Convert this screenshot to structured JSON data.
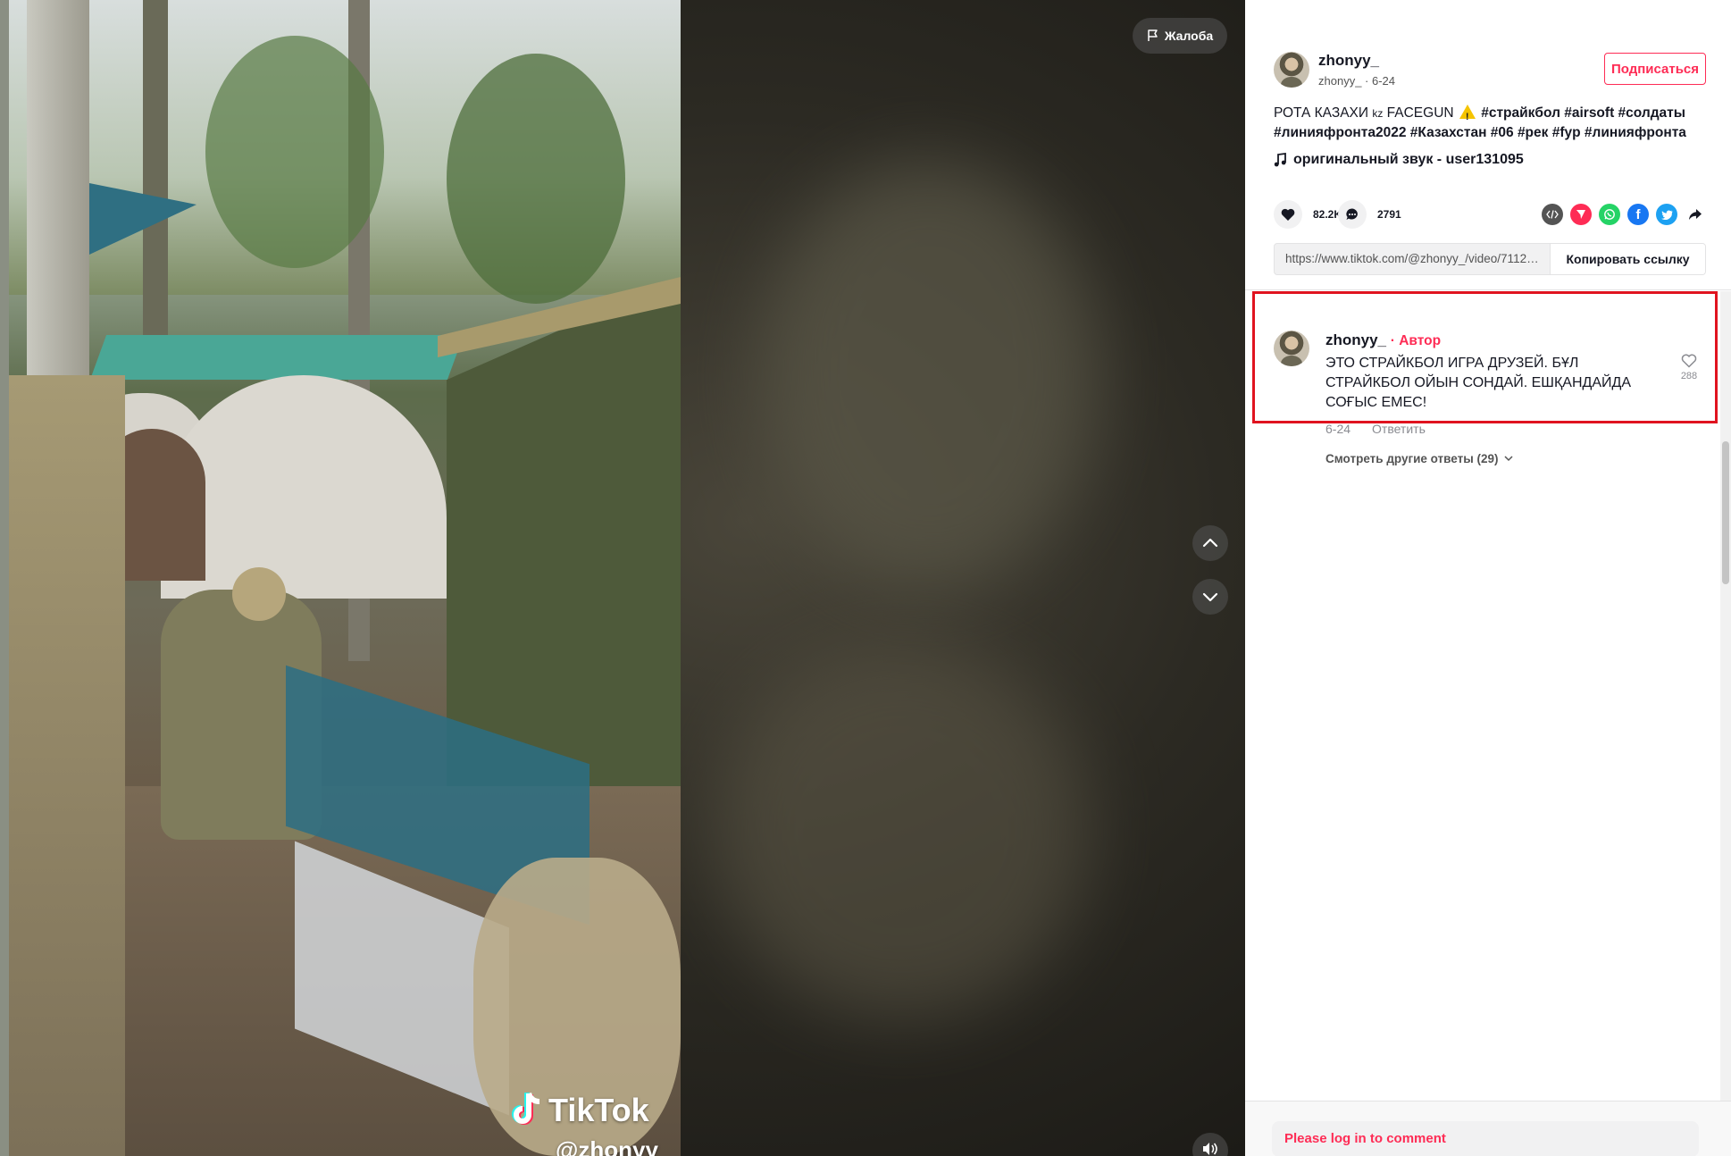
{
  "video": {
    "report_label": "Жалоба",
    "watermark_brand": "TikTok",
    "watermark_user": "@zhonyy_"
  },
  "author": {
    "username": "zhonyy_",
    "nickname": "zhonyy_",
    "date": "6-24",
    "follow_label": "Подписаться"
  },
  "description": {
    "text_prefix": "РОТА КАЗАХИ ",
    "kz": "kz",
    "text_mid": " FACEGUN ",
    "hashtags": [
      "#страйкбол",
      "#airsoft",
      "#солдаты",
      "#линияфронта2022",
      "#Казахстан",
      "#06",
      "#рек",
      "#fyp",
      "#линияфронта"
    ]
  },
  "music": {
    "title": "оригинальный звук - user131095"
  },
  "stats": {
    "likes": "82.2K",
    "comments": "2791"
  },
  "share": {
    "link": "https://www.tiktok.com/@zhonyy_/video/71126...",
    "copy_label": "Копировать ссылку",
    "colors": {
      "embed": "#545454",
      "send": "#fe2c55",
      "whatsapp": "#25d366",
      "facebook": "#1877f2",
      "twitter": "#1da1f2"
    }
  },
  "comment": {
    "username": "zhonyy_",
    "author_badge": "· Автор",
    "text": "ЭТО СТРАЙКБОЛ ИГРА ДРУЗЕЙ. БҰЛ СТРАЙКБОЛ ОЙЫН СОНДАЙ. ЕШҚАНДАЙДА СОҒЫС ЕМЕС!",
    "date": "6-24",
    "reply_label": "Ответить",
    "likes": "288",
    "more_replies": "Смотреть другие ответы (29)"
  },
  "footer": {
    "login_prompt": "Please log in to comment"
  }
}
